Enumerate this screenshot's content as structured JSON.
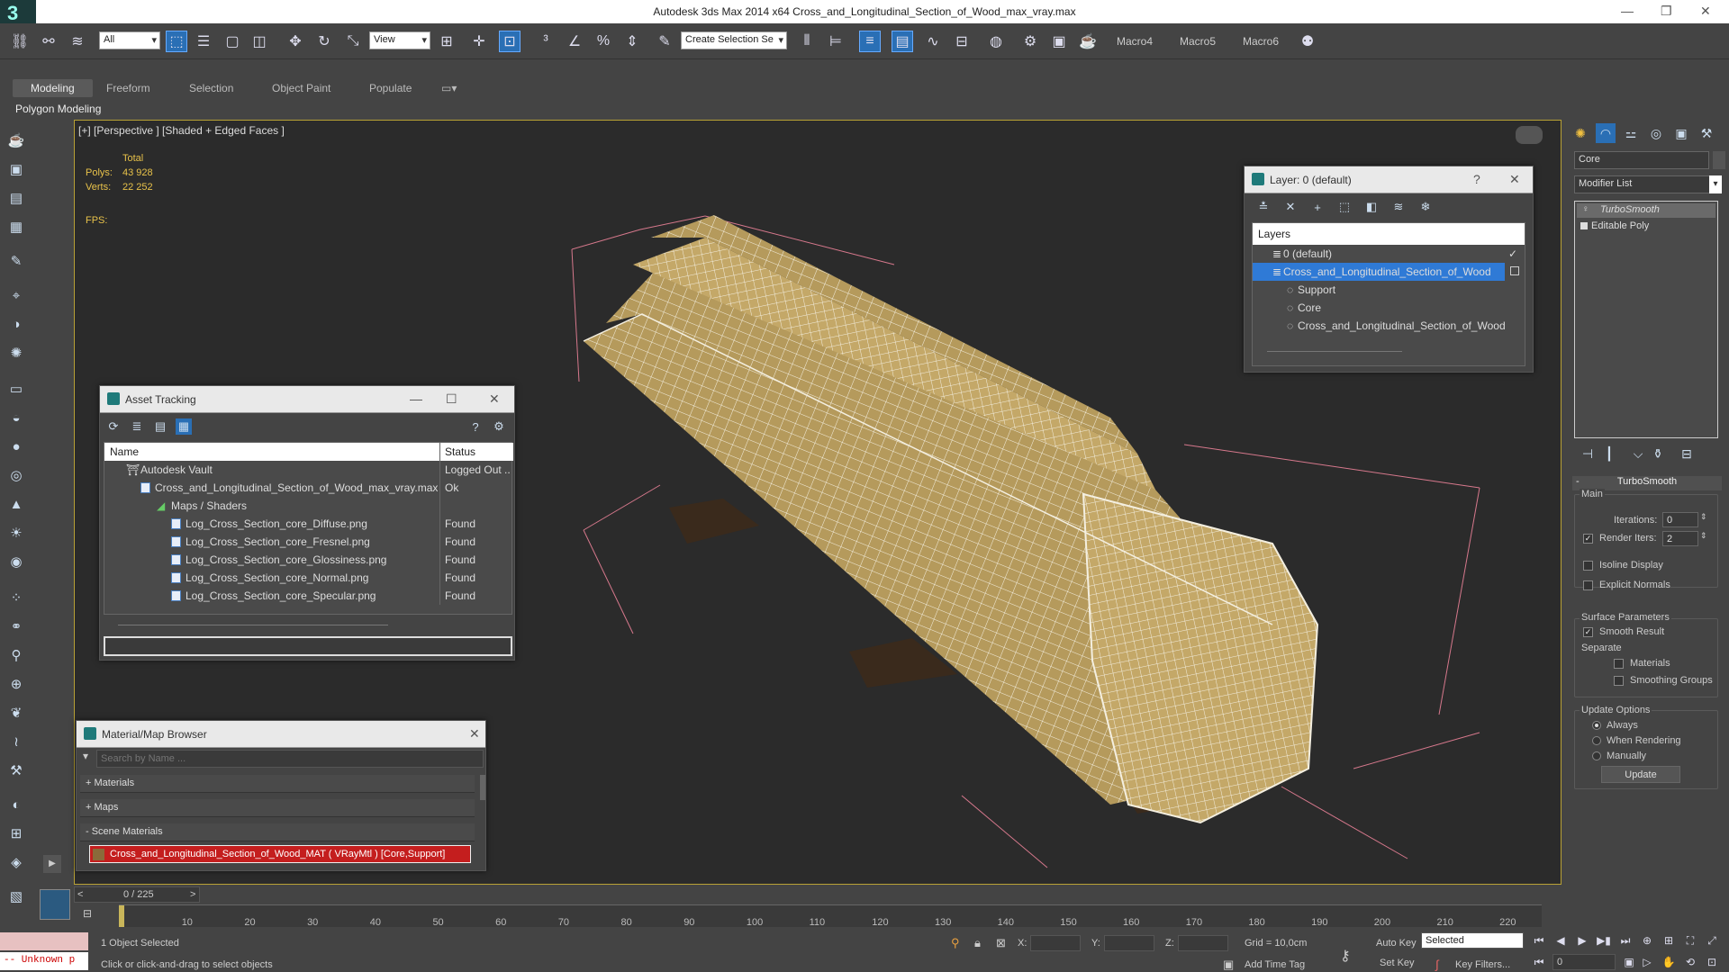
{
  "app": {
    "title": "Autodesk 3ds Max  2014 x64     Cross_and_Longitudinal_Section_of_Wood_max_vray.max",
    "logo_icon": "3ds-max-logo-icon"
  },
  "toolbar": {
    "selection_filter": "All",
    "ref_coord": "View",
    "named_selection": "Create Selection Se",
    "macros": [
      "Macro4",
      "Macro5",
      "Macro6"
    ]
  },
  "ribbon": {
    "tabs": [
      "Modeling",
      "Freeform",
      "Selection",
      "Object Paint",
      "Populate"
    ],
    "active_tab": "Modeling",
    "panel_label": "Polygon Modeling"
  },
  "viewport": {
    "label": "[+] [Perspective ] [Shaded + Edged Faces ]",
    "stats": {
      "total_label": "Total",
      "polys_label": "Polys:",
      "polys_value": "43 928",
      "verts_label": "Verts:",
      "verts_value": "22 252",
      "fps_label": "FPS:"
    },
    "wood_color": "#b59a5c",
    "wire_color": "#f4efe0"
  },
  "asset_tracking": {
    "title": "Asset Tracking",
    "col_name": "Name",
    "col_status": "Status",
    "rows": [
      {
        "name": "Autodesk Vault",
        "status": "Logged Out .."
      },
      {
        "name": "Cross_and_Longitudinal_Section_of_Wood_max_vray.max",
        "status": "Ok"
      },
      {
        "name": "Maps / Shaders",
        "status": ""
      },
      {
        "name": "Log_Cross_Section_core_Diffuse.png",
        "status": "Found"
      },
      {
        "name": "Log_Cross_Section_core_Fresnel.png",
        "status": "Found"
      },
      {
        "name": "Log_Cross_Section_core_Glossiness.png",
        "status": "Found"
      },
      {
        "name": "Log_Cross_Section_core_Normal.png",
        "status": "Found"
      },
      {
        "name": "Log_Cross_Section_core_Specular.png",
        "status": "Found"
      }
    ]
  },
  "layer_window": {
    "title": "Layer: 0 (default)",
    "header": "Layers",
    "rows": [
      {
        "name": "0 (default)"
      },
      {
        "name": "Cross_and_Longitudinal_Section_of_Wood"
      },
      {
        "name": "Support"
      },
      {
        "name": "Core"
      },
      {
        "name": "Cross_and_Longitudinal_Section_of_Wood"
      }
    ]
  },
  "material_browser": {
    "title": "Material/Map Browser",
    "search_placeholder": "Search by Name ...",
    "sections": [
      "+ Materials",
      "+ Maps",
      "- Scene Materials"
    ],
    "scene_material": "Cross_and_Longitudinal_Section_of_Wood_MAT ( VRayMtl ) [Core,Support]"
  },
  "command_panel": {
    "object_name": "Core",
    "modifier_list": "Modifier List",
    "stack": [
      "TurboSmooth",
      "Editable Poly"
    ],
    "rollout_title": "TurboSmooth",
    "main_label": "Main",
    "iterations_label": "Iterations:",
    "iterations_value": "0",
    "render_iters_label": "Render Iters:",
    "render_iters_value": "2",
    "isoline_label": "Isoline Display",
    "explicit_label": "Explicit Normals",
    "surface_label": "Surface Parameters",
    "smooth_label": "Smooth Result",
    "separate_label": "Separate",
    "materials_label": "Materials",
    "smoothing_label": "Smoothing Groups",
    "update_options_label": "Update Options",
    "always_label": "Always",
    "when_rendering_label": "When Rendering",
    "manually_label": "Manually",
    "update_button": "Update"
  },
  "timeline": {
    "frame_counter": "0 / 225",
    "ticks": [
      "10",
      "20",
      "30",
      "40",
      "50",
      "60",
      "70",
      "80",
      "90",
      "100",
      "110",
      "120",
      "130",
      "140",
      "150",
      "160",
      "170",
      "180",
      "190",
      "200",
      "210",
      "220"
    ]
  },
  "status_bar": {
    "script_listener": "-- Unknown p",
    "selection_status": "1 Object Selected",
    "prompt": "Click or click-and-drag to select objects",
    "x_label": "X:",
    "y_label": "Y:",
    "z_label": "Z:",
    "grid": "Grid = 10,0cm",
    "add_time_tag": "Add Time Tag",
    "auto_key": "Auto Key",
    "set_key": "Set Key",
    "key_mode": "Selected",
    "key_filters": "Key Filters...",
    "current_frame": "0"
  }
}
